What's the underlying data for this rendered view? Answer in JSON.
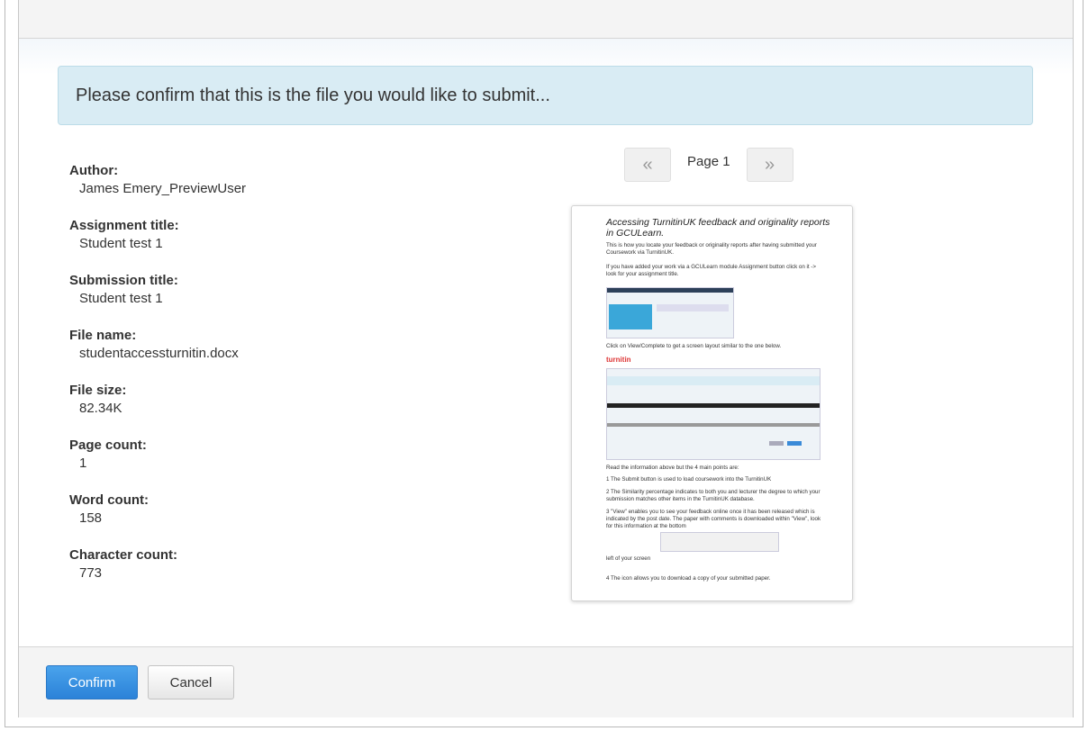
{
  "banner": {
    "text": "Please confirm that this is the file you would like to submit..."
  },
  "details": [
    {
      "label": "Author:",
      "value": "James Emery_PreviewUser"
    },
    {
      "label": "Assignment title:",
      "value": "Student test 1"
    },
    {
      "label": "Submission title:",
      "value": "Student test 1"
    },
    {
      "label": "File name:",
      "value": "studentaccessturnitin.docx"
    },
    {
      "label": "File size:",
      "value": "82.34K"
    },
    {
      "label": "Page count:",
      "value": "1"
    },
    {
      "label": "Word count:",
      "value": "158"
    },
    {
      "label": "Character count:",
      "value": "773"
    }
  ],
  "pager": {
    "prev": "«",
    "label": "Page 1",
    "next": "»"
  },
  "preview": {
    "title": "Accessing TurnitinUK feedback and originality reports in GCULearn.",
    "lines": [
      "This is how you locate your feedback or originality reports after having submitted your Coursework via TurnitinUK.",
      "If you have added your work via a GCULearn module Assignment button click on it -> look for your assignment title.",
      "Click on View/Complete to get a screen layout similar to the one below.",
      "Read the information above but the 4 main points are:",
      "1 The Submit button is used to load coursework into the TurnitinUK",
      "2 The Similarity percentage indicates to both you and lecturer the degree to which your submission matches other items in the TurnitinUK database.",
      "3 \"View\" enables you to see your feedback online once it has been released which is indicated by the post date. The paper with comments is downloaded within \"View\", look for this information at the bottom",
      "left of your screen",
      "4 The      icon allows you to download a copy of your submitted paper."
    ]
  },
  "footer": {
    "confirm": "Confirm",
    "cancel": "Cancel"
  },
  "colors": {
    "confirm_button": "#2b82d8",
    "banner_bg": "#d9ecf4"
  }
}
